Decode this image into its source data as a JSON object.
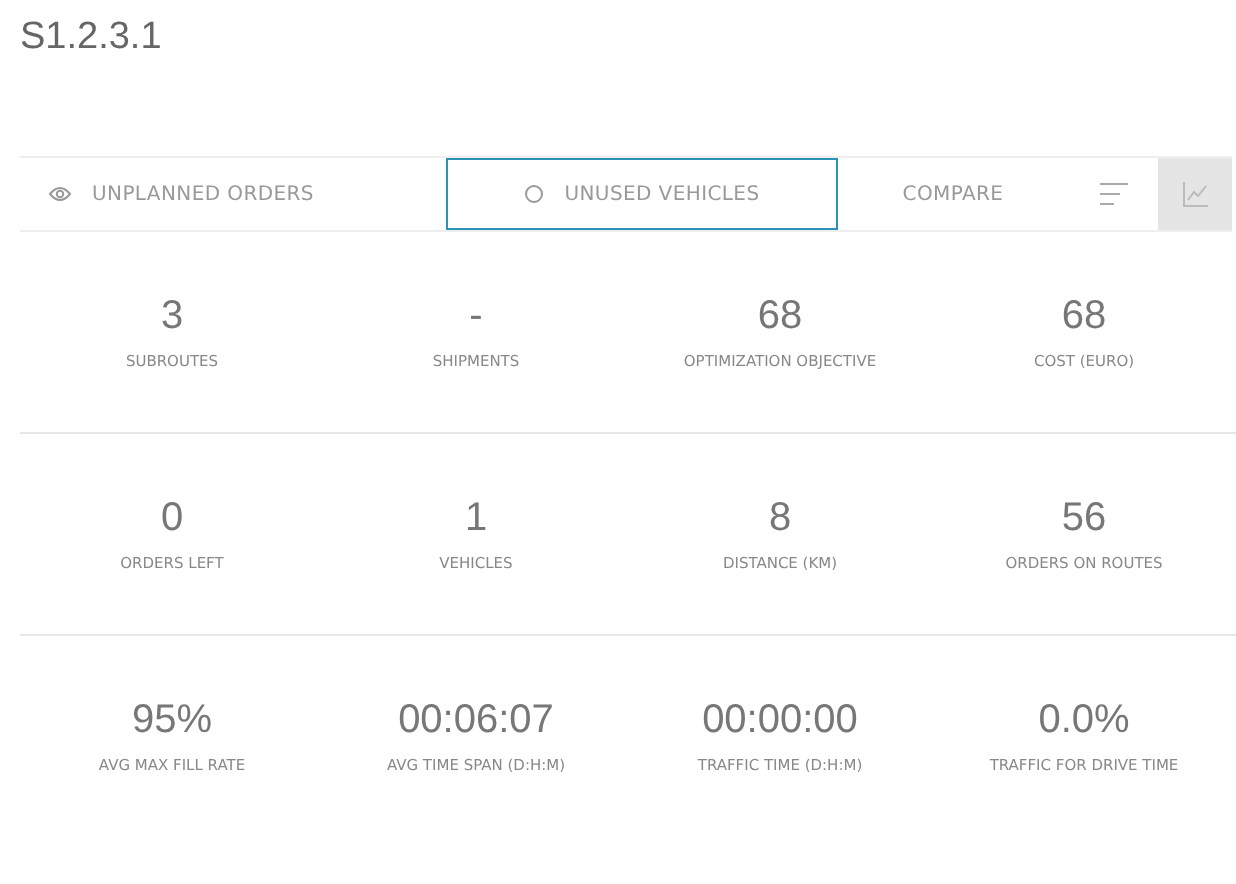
{
  "title": "S1.2.3.1",
  "tabs": [
    {
      "label": "UNPLANNED ORDERS",
      "kind": "eye",
      "selected": false
    },
    {
      "label": "UNUSED VEHICLES",
      "kind": "circle",
      "selected": true
    },
    {
      "label": "COMPARE",
      "kind": "text",
      "selected": false
    }
  ],
  "views": [
    {
      "kind": "list",
      "selected": false
    },
    {
      "kind": "chart",
      "selected": true
    }
  ],
  "stats": [
    [
      {
        "value": "3",
        "label": "SUBROUTES"
      },
      {
        "value": "-",
        "label": "SHIPMENTS"
      },
      {
        "value": "68",
        "label": "OPTIMIZATION OBJECTIVE"
      },
      {
        "value": "68",
        "label": "COST (EURO)"
      }
    ],
    [
      {
        "value": "0",
        "label": "ORDERS LEFT"
      },
      {
        "value": "1",
        "label": "VEHICLES"
      },
      {
        "value": "8",
        "label": "DISTANCE (KM)"
      },
      {
        "value": "56",
        "label": "ORDERS ON ROUTES"
      }
    ],
    [
      {
        "value": "95%",
        "label": "AVG MAX FILL RATE"
      },
      {
        "value": "00:06:07",
        "label": "AVG TIME SPAN (D:H:M)"
      },
      {
        "value": "00:00:00",
        "label": "TRAFFIC TIME (D:H:M)"
      },
      {
        "value": "0.0%",
        "label": "TRAFFIC FOR DRIVE TIME"
      }
    ]
  ]
}
